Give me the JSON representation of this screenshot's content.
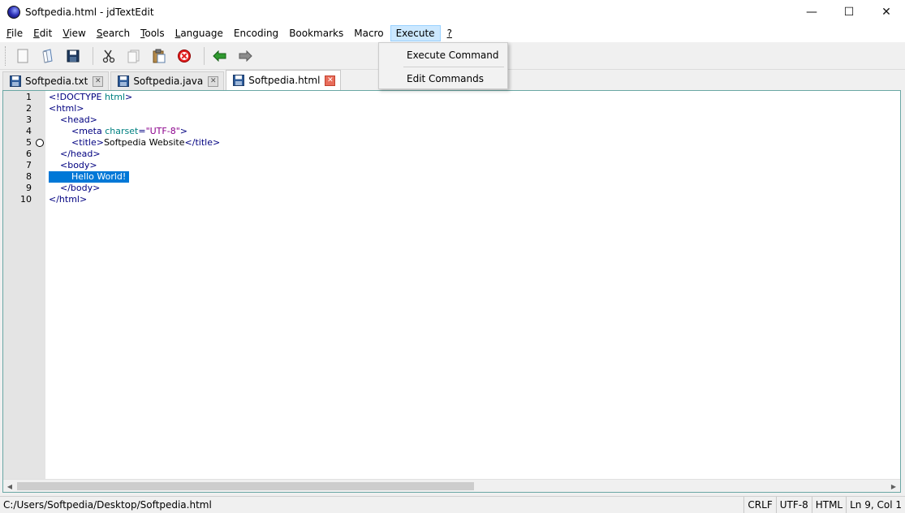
{
  "window": {
    "title": "Softpedia.html - jdTextEdit",
    "controls": {
      "minimize": "—",
      "maximize": "☐",
      "close": "✕"
    }
  },
  "menu": {
    "items": [
      {
        "label": "File",
        "underline": "F",
        "rest": "ile"
      },
      {
        "label": "Edit",
        "underline": "E",
        "rest": "dit"
      },
      {
        "label": "View",
        "underline": "V",
        "rest": "iew"
      },
      {
        "label": "Search",
        "underline": "S",
        "rest": "earch"
      },
      {
        "label": "Tools",
        "underline": "T",
        "rest": "ools"
      },
      {
        "label": "Language",
        "underline": "L",
        "rest": "anguage"
      },
      {
        "label": "Encoding",
        "underline": "",
        "rest": "Encoding"
      },
      {
        "label": "Bookmarks",
        "underline": "",
        "rest": "Bookmarks"
      },
      {
        "label": "Macro",
        "underline": "",
        "rest": "Macro"
      },
      {
        "label": "Execute",
        "underline": "",
        "rest": "Execute"
      },
      {
        "label": "?",
        "underline": "?",
        "rest": ""
      }
    ],
    "active_index": 9
  },
  "execute_menu": {
    "items": [
      "Execute Command",
      "Edit Commands"
    ]
  },
  "toolbar": {
    "icons": [
      "new-file-icon",
      "open-file-icon",
      "save-icon",
      "cut-icon",
      "copy-icon",
      "paste-icon",
      "delete-icon",
      "undo-icon",
      "redo-icon"
    ]
  },
  "tabs": [
    {
      "label": "Softpedia.txt",
      "active": false
    },
    {
      "label": "Softpedia.java",
      "active": false
    },
    {
      "label": "Softpedia.html",
      "active": true
    }
  ],
  "editor": {
    "line_numbers": [
      "1",
      "2",
      "3",
      "4",
      "5",
      "6",
      "7",
      "8",
      "9",
      "10"
    ],
    "breakpoint_line": 5,
    "selected_line": 8,
    "lines": [
      [
        {
          "t": "tag",
          "v": "<!DOCTYPE "
        },
        {
          "t": "attr",
          "v": "html"
        },
        {
          "t": "tag",
          "v": ">"
        }
      ],
      [
        {
          "t": "tag",
          "v": "<html>"
        }
      ],
      [
        {
          "t": "text",
          "v": "    "
        },
        {
          "t": "tag",
          "v": "<head>"
        }
      ],
      [
        {
          "t": "text",
          "v": "        "
        },
        {
          "t": "tag",
          "v": "<meta "
        },
        {
          "t": "attr",
          "v": "charset"
        },
        {
          "t": "tag",
          "v": "="
        },
        {
          "t": "val",
          "v": "\"UTF-8\""
        },
        {
          "t": "tag",
          "v": ">"
        }
      ],
      [
        {
          "t": "text",
          "v": "        "
        },
        {
          "t": "tag",
          "v": "<title>"
        },
        {
          "t": "text",
          "v": "Softpedia Website"
        },
        {
          "t": "tag",
          "v": "</title>"
        }
      ],
      [
        {
          "t": "text",
          "v": "    "
        },
        {
          "t": "tag",
          "v": "</head>"
        }
      ],
      [
        {
          "t": "text",
          "v": "    "
        },
        {
          "t": "tag",
          "v": "<body>"
        }
      ],
      [
        {
          "t": "text",
          "v": "        Hello World!"
        }
      ],
      [
        {
          "t": "text",
          "v": "    "
        },
        {
          "t": "tag",
          "v": "</body>"
        }
      ],
      [
        {
          "t": "tag",
          "v": "</html>"
        }
      ]
    ]
  },
  "status": {
    "path": "C:/Users/Softpedia/Desktop/Softpedia.html",
    "line_ending": "CRLF",
    "encoding": "UTF-8",
    "language": "HTML",
    "position": "Ln 9, Col 1"
  },
  "colors": {
    "tag": "#000080",
    "attr": "#008080",
    "value": "#8b008b",
    "selection": "#0078d7",
    "menu_active": "#cce8ff"
  }
}
